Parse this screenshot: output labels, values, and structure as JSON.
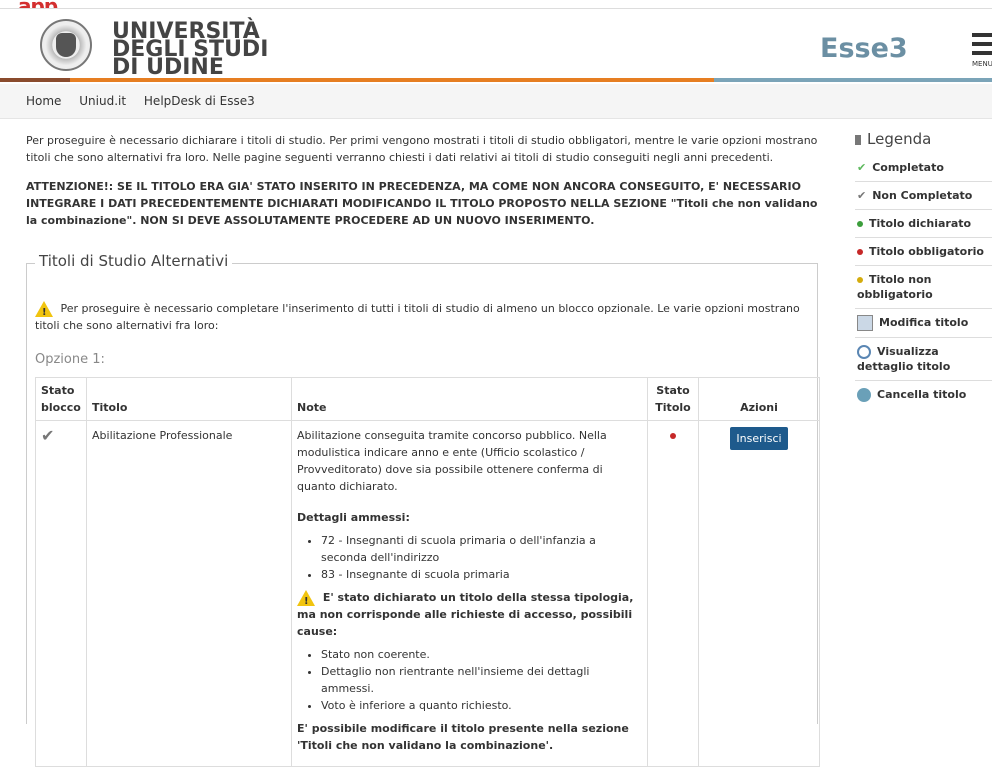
{
  "header": {
    "uni_line1": "UNIVERSITÀ",
    "uni_line2": "DEGLI STUDI",
    "uni_line3": "DI UDINE",
    "app_name": "Esse3",
    "menu_label": "MENU"
  },
  "nav": {
    "items": [
      "Home",
      "Uniud.it",
      "HelpDesk di Esse3"
    ]
  },
  "intro": "Per proseguire è necessario dichiarare i titoli di studio. Per primi vengono mostrati i titoli di studio obbligatori, mentre le varie opzioni mostrano titoli che sono alternativi fra loro. Nelle pagine seguenti verranno chiesti i dati relativi ai titoli di studio conseguiti negli anni precedenti.",
  "attention": "ATTENZIONE!: SE IL TITOLO ERA GIA' STATO INSERITO IN PRECEDENZA, MA COME NON ANCORA CONSEGUITO, E' NECESSARIO INTEGRARE I DATI PRECEDENTEMENTE DICHIARATI MODIFICANDO IL TITOLO PROPOSTO NELLA SEZIONE \"Titoli che non validano la combinazione\". NON SI DEVE ASSOLUTAMENTE PROCEDERE AD UN NUOVO INSERIMENTO.",
  "section": {
    "title": "Titoli di Studio Alternativi",
    "note": "Per proseguire è necessario completare l'inserimento di tutti i titoli di studio di almeno un blocco opzionale. Le varie opzioni mostrano titoli che sono alternativi fra loro:",
    "option_label": "Opzione 1:"
  },
  "table": {
    "headers": [
      "Stato blocco",
      "Titolo",
      "Note",
      "Stato Titolo",
      "Azioni"
    ],
    "row": {
      "titolo": "Abilitazione Professionale",
      "note_main": "Abilitazione conseguita tramite concorso pubblico. Nella modulistica indicare anno e ente (Ufficio scolastico / Provveditorato) dove sia possibile ottenere conferma di quanto dichiarato.",
      "dettagli_title": "Dettagli ammessi:",
      "dettagli": [
        "72 - Insegnanti di scuola primaria o dell'infanzia a seconda dell'indirizzo",
        "83 - Insegnante di scuola primaria"
      ],
      "warning_title": "E' stato dichiarato un titolo della stessa tipologia, ma non corrisponde alle richieste di accesso, possibili cause:",
      "causes": [
        "Stato non coerente.",
        "Dettaglio non rientrante nell'insieme dei dettagli ammessi.",
        "Voto è inferiore a quanto richiesto."
      ],
      "final_note": "E' possibile modificare il titolo presente nella sezione 'Titoli che non validano la combinazione'.",
      "action_label": "Inserisci"
    }
  },
  "legend": {
    "title": "Legenda",
    "items": [
      "Completato",
      "Non Completato",
      "Titolo dichiarato",
      "Titolo obbligatorio",
      "Titolo non obbligatorio",
      "Modifica titolo",
      "Visualizza dettaglio titolo",
      "Cancella titolo"
    ]
  }
}
